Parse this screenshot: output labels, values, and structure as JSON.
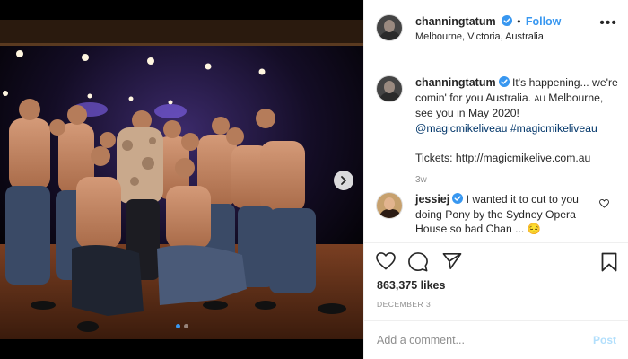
{
  "photo": {
    "icon": "chevron-right-icon",
    "carousel": {
      "count": 2,
      "active_index": 0
    }
  },
  "header": {
    "username": "channingtatum",
    "separator": "•",
    "follow_label": "Follow",
    "location": "Melbourne, Victoria, Australia",
    "verified_icon": "verified-badge-icon",
    "more_icon": "more-options-icon"
  },
  "caption": {
    "username": "channingtatum",
    "text_1": "It's happening... we're comin' for you Australia. ",
    "au": "AU",
    "text_2": " Melbourne, see you in May 2020! ",
    "tag_1": "@magicmikeliveau",
    "tag_2": "#magicmikeliveau",
    "tickets": "Tickets: http://magicmikelive.com.au",
    "time": "3w"
  },
  "comment": {
    "username": "jessiej",
    "text": "I wanted it to cut to you doing Pony by the Sydney Opera House so bad Chan ... ",
    "emoji": "😔"
  },
  "actions": {
    "icons": [
      "heart-icon",
      "comment-icon",
      "share-icon",
      "bookmark-icon"
    ],
    "likes": "863,375 likes",
    "date": "DECEMBER 3"
  },
  "add_comment": {
    "placeholder": "Add a comment...",
    "post_label": "Post"
  },
  "colors": {
    "accent": "#3897f0",
    "post_disabled": "#b2dffc",
    "muted": "#8e8e8e",
    "hashtag": "#003569"
  }
}
